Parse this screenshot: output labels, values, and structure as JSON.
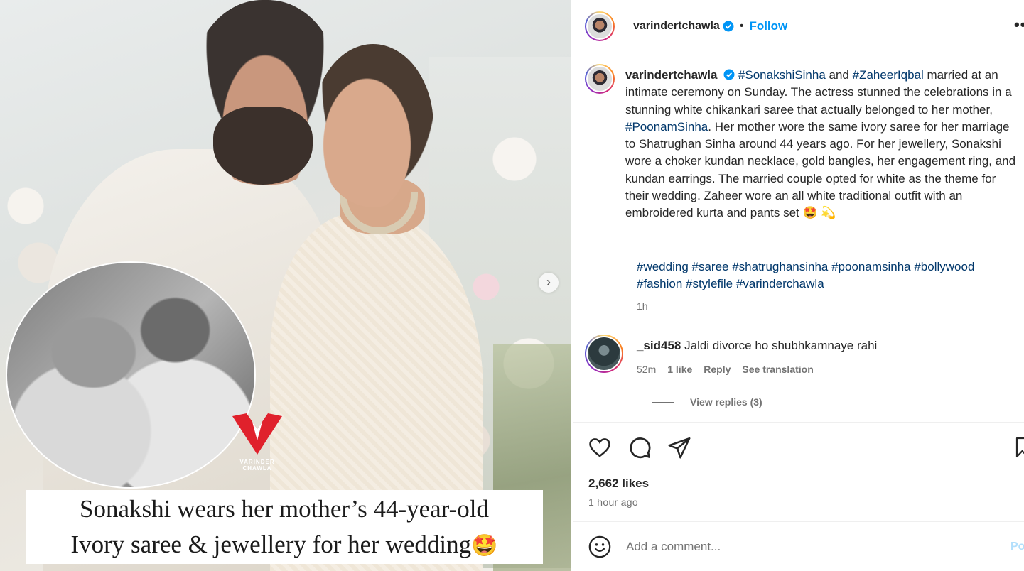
{
  "media": {
    "overlay_caption_line1": "Sonakshi wears her mother’s 44-year-old",
    "overlay_caption_line2": "Ivory saree & jewellery for her wedding",
    "overlay_caption_emoji": "🤩",
    "watermark_text": "VARINDER CHAWLA",
    "next_icon": "chevron-right-icon"
  },
  "header": {
    "username": "varindertchawla",
    "separator": "•",
    "follow_label": "Follow",
    "more_icon": "more-options-icon",
    "more_label": "•••"
  },
  "caption": {
    "username": "varindertchawla",
    "tag1": "#SonakshiSinha",
    "and": " and ",
    "tag2": "#ZaheerIqbal",
    "text1": " married at an intimate ceremony on Sunday. The actress stunned the celebrations in a stunning white chikankari saree that actually belonged to her mother, ",
    "tag3": "#PoonamSinha",
    "text2": ". Her mother wore the same ivory saree for her marriage to Shatrughan Sinha around 44 years ago. For her jewellery, Sonakshi wore a choker kundan necklace, gold bangles, her engagement ring, and kundan earrings. The married couple opted for white as the theme for their wedding. Zaheer wore an all white traditional outfit with an embroidered kurta and pants set 🤩 💫",
    "hashtags": "#wedding #saree #shatrughansinha #poonamsinha #bollywood #fashion #stylefile #varinderchawla",
    "time": "1h"
  },
  "comment": {
    "username": "_sid458",
    "text": " Jaldi divorce ho shubhkamnaye rahi",
    "time": "52m",
    "likes": "1 like",
    "reply": "Reply",
    "translate": "See translation",
    "view_replies": "View replies (3)"
  },
  "actions": {
    "likes": "2,662 likes",
    "ago": "1 hour ago"
  },
  "add_comment": {
    "placeholder": "Add a comment...",
    "post_label": "Post"
  },
  "colors": {
    "link_blue": "#0095f6",
    "hashtag": "#00376b",
    "muted": "#737373",
    "logo_red": "#e0212c"
  }
}
